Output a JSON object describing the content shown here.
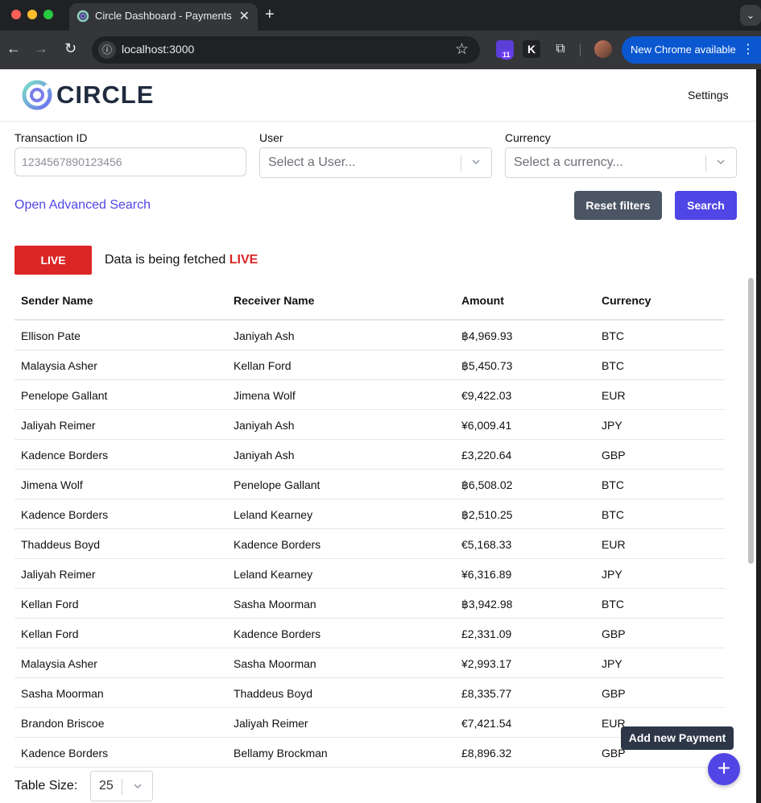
{
  "browser": {
    "tab_title": "Circle Dashboard - Payments",
    "tab_close": "✕",
    "new_tab": "+",
    "url": "localhost:3000",
    "extension_badge": "11",
    "extension_k": "K",
    "update_label": "New Chrome available",
    "colors": {
      "update_button": "#0b57d0",
      "chrome_dark": "#202124"
    }
  },
  "app": {
    "logo_text": "CIRCLE",
    "settings_label": "Settings"
  },
  "filters": {
    "transaction_label": "Transaction ID",
    "transaction_placeholder": "1234567890123456",
    "user_label": "User",
    "user_placeholder": "Select a User...",
    "currency_label": "Currency",
    "currency_placeholder": "Select a currency...",
    "advanced_link": "Open Advanced Search",
    "reset_label": "Reset filters",
    "search_label": "Search"
  },
  "live": {
    "badge": "LIVE",
    "status_prefix": "Data is being fetched",
    "status_word": "LIVE",
    "color": "#dc2626"
  },
  "table": {
    "headers": [
      "Sender Name",
      "Receiver Name",
      "Amount",
      "Currency"
    ],
    "rows": [
      [
        "Ellison Pate",
        "Janiyah Ash",
        "฿4,969.93",
        "BTC"
      ],
      [
        "Malaysia Asher",
        "Kellan Ford",
        "฿5,450.73",
        "BTC"
      ],
      [
        "Penelope Gallant",
        "Jimena Wolf",
        "€9,422.03",
        "EUR"
      ],
      [
        "Jaliyah Reimer",
        "Janiyah Ash",
        "¥6,009.41",
        "JPY"
      ],
      [
        "Kadence Borders",
        "Janiyah Ash",
        "£3,220.64",
        "GBP"
      ],
      [
        "Jimena Wolf",
        "Penelope Gallant",
        "฿6,508.02",
        "BTC"
      ],
      [
        "Kadence Borders",
        "Leland Kearney",
        "฿2,510.25",
        "BTC"
      ],
      [
        "Thaddeus Boyd",
        "Kadence Borders",
        "€5,168.33",
        "EUR"
      ],
      [
        "Jaliyah Reimer",
        "Leland Kearney",
        "¥6,316.89",
        "JPY"
      ],
      [
        "Kellan Ford",
        "Sasha Moorman",
        "฿3,942.98",
        "BTC"
      ],
      [
        "Kellan Ford",
        "Kadence Borders",
        "£2,331.09",
        "GBP"
      ],
      [
        "Malaysia Asher",
        "Sasha Moorman",
        "¥2,993.17",
        "JPY"
      ],
      [
        "Sasha Moorman",
        "Thaddeus Boyd",
        "£8,335.77",
        "GBP"
      ],
      [
        "Brandon Briscoe",
        "Jaliyah Reimer",
        "€7,421.54",
        "EUR"
      ],
      [
        "Kadence Borders",
        "Bellamy Brockman",
        "£8,896.32",
        "GBP"
      ]
    ]
  },
  "footer": {
    "table_size_label": "Table Size:",
    "table_size_value": "25",
    "add_payment_tooltip": "Add new Payment",
    "fab_icon": "+",
    "accent": "#4f46e5"
  }
}
